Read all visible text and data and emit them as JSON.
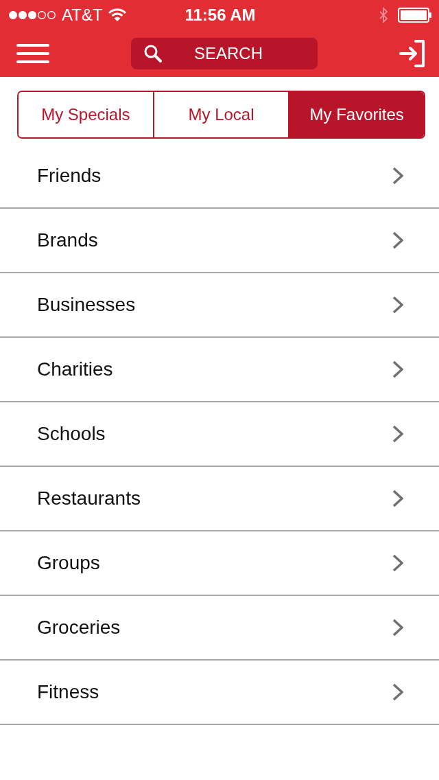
{
  "status_bar": {
    "carrier": "AT&T",
    "time": "11:56 AM"
  },
  "nav_bar": {
    "search": {
      "placeholder": "SEARCH"
    }
  },
  "tabs": [
    {
      "label": "My Specials",
      "selected": false
    },
    {
      "label": "My Local",
      "selected": false
    },
    {
      "label": "My Favorites",
      "selected": true
    }
  ],
  "list": [
    {
      "label": "Friends"
    },
    {
      "label": "Brands"
    },
    {
      "label": "Businesses"
    },
    {
      "label": "Charities"
    },
    {
      "label": "Schools"
    },
    {
      "label": "Restaurants"
    },
    {
      "label": "Groups"
    },
    {
      "label": "Groceries"
    },
    {
      "label": "Fitness"
    }
  ]
}
